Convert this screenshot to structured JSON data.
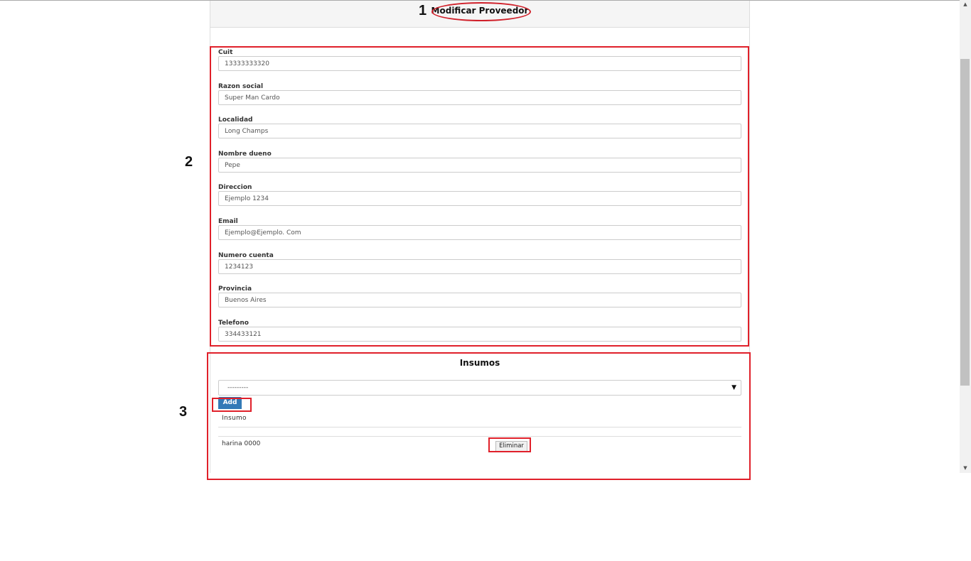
{
  "header": {
    "title": "Modificar Proveedor"
  },
  "fields": [
    {
      "label": "Cuit",
      "value": "13333333320"
    },
    {
      "label": "Razon social",
      "value": "Super Man Cardo"
    },
    {
      "label": "Localidad",
      "value": "Long Champs"
    },
    {
      "label": "Nombre dueno",
      "value": "Pepe"
    },
    {
      "label": "Direccion",
      "value": "Ejemplo 1234"
    },
    {
      "label": "Email",
      "value": "Ejemplo@Ejemplo. Com"
    },
    {
      "label": "Numero cuenta",
      "value": "1234123"
    },
    {
      "label": "Provincia",
      "value": "Buenos Aires"
    },
    {
      "label": "Telefono",
      "value": "334433121"
    }
  ],
  "insumos": {
    "title": "Insumos",
    "select_value": "---------",
    "add_label": "Add",
    "column_header": "Insumo",
    "rows": [
      {
        "name": "harina 0000",
        "action": "Eliminar"
      }
    ]
  },
  "annotations": {
    "n1": "1",
    "n2": "2",
    "n3": "3",
    "color": "#e0202a"
  },
  "colors": {
    "primary": "#337ab7",
    "header_bg": "#f5f5f5"
  }
}
